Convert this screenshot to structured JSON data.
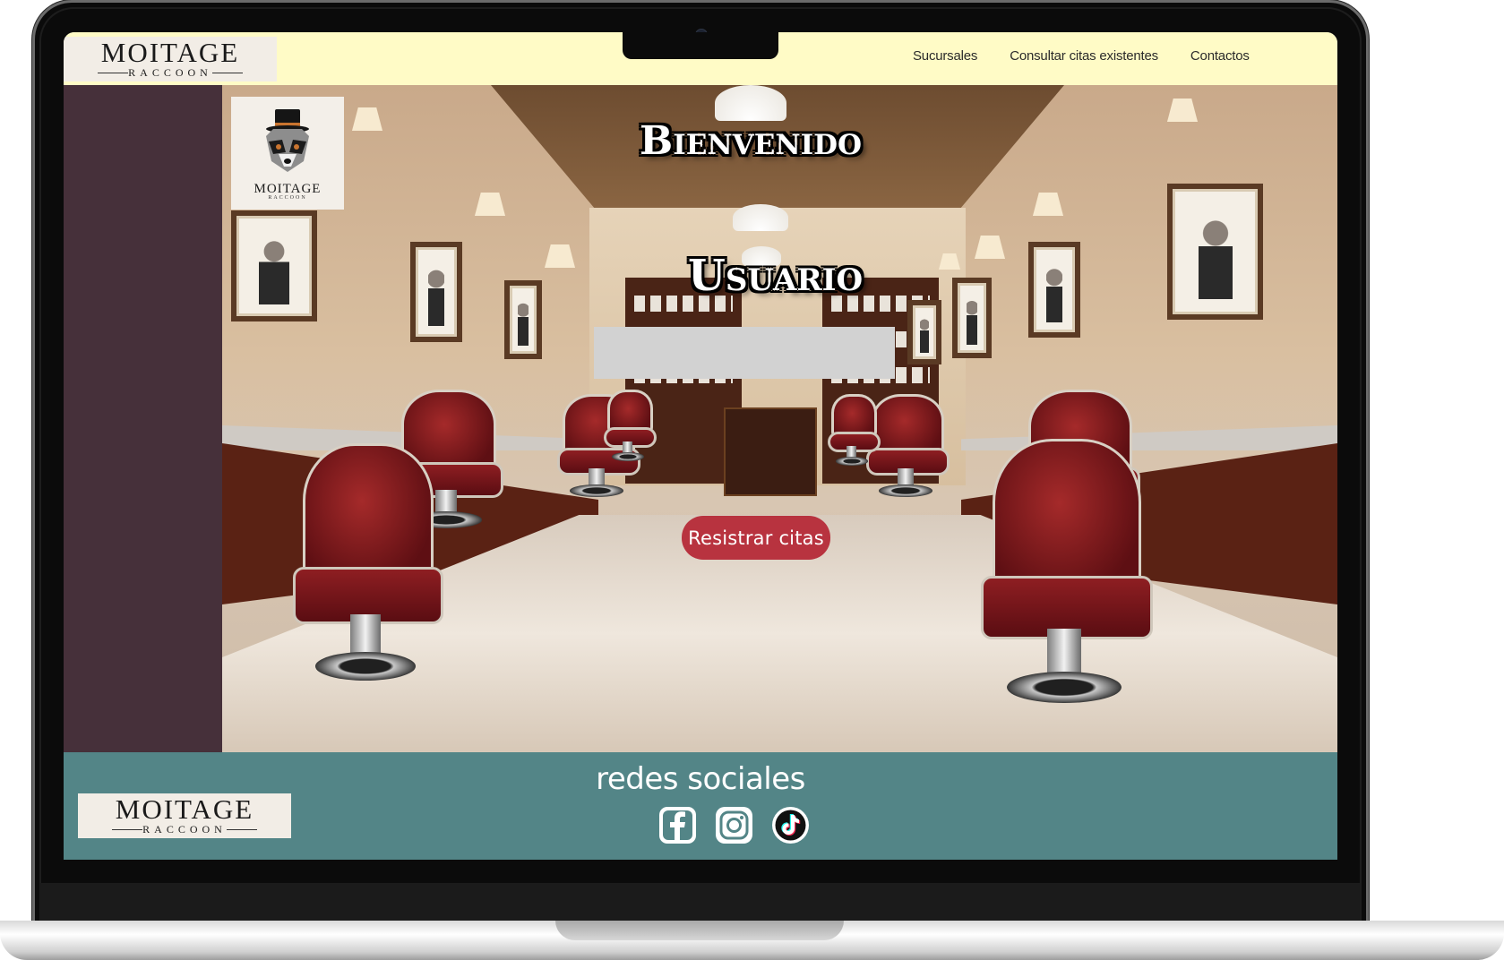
{
  "brand": {
    "name": "MOITAGE",
    "tagline": "RACCOON"
  },
  "nav": {
    "items": [
      {
        "label": "Sucursales"
      },
      {
        "label": "Consultar citas existentes"
      },
      {
        "label": "Contactos"
      }
    ]
  },
  "hero": {
    "welcome_title": "Bienvenido",
    "user_title": "Usuario",
    "user_input_value": "",
    "submit_label": "Resistrar citas",
    "accent_color": "#b8333f"
  },
  "footer": {
    "social_title": "redes sociales",
    "social_icons": [
      "facebook-icon",
      "instagram-icon",
      "tiktok-icon"
    ],
    "background_color": "#538587"
  },
  "colors": {
    "topbar": "#fffbc6",
    "sidebar": "#46303a"
  }
}
